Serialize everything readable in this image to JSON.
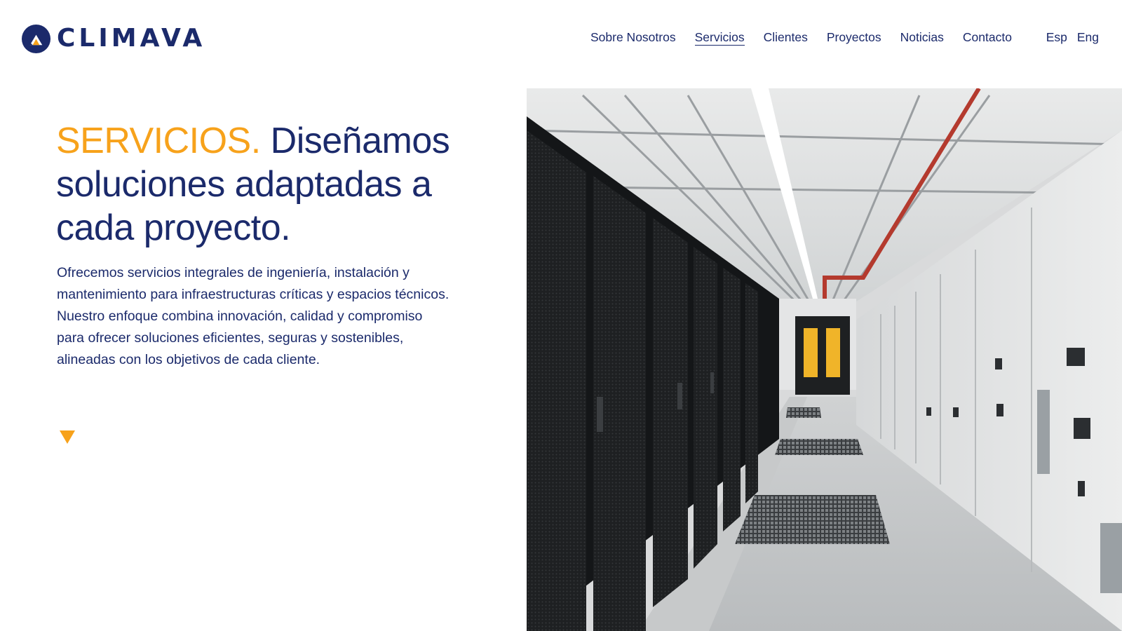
{
  "brand": {
    "name": "CLIMAVA",
    "logo_icon": "climava-logo-icon",
    "colors": {
      "primary": "#1b2a6b",
      "accent": "#f7a21b"
    }
  },
  "nav": {
    "items": [
      {
        "label": "Sobre Nosotros",
        "active": false
      },
      {
        "label": "Servicios",
        "active": true
      },
      {
        "label": "Clientes",
        "active": false
      },
      {
        "label": "Proyectos",
        "active": false
      },
      {
        "label": "Noticias",
        "active": false
      },
      {
        "label": "Contacto",
        "active": false
      }
    ],
    "languages": [
      {
        "label": "Esp"
      },
      {
        "label": "Eng"
      }
    ]
  },
  "hero": {
    "title_accent": "SERVICIOS.",
    "title_rest": " Diseñamos soluciones adaptadas a cada proyecto.",
    "body": "Ofrecemos servicios integrales de ingeniería, instalación y mantenimiento para infraestructuras críticas y espacios técnicos. Nuestro enfoque combina innovación, calidad y compromiso para ofrecer soluciones eficientes, seguras y sostenibles, alineadas con los objetivos de cada cliente.",
    "scroll_icon": "triangle-down-icon",
    "image_icon": "data-center-photo"
  }
}
